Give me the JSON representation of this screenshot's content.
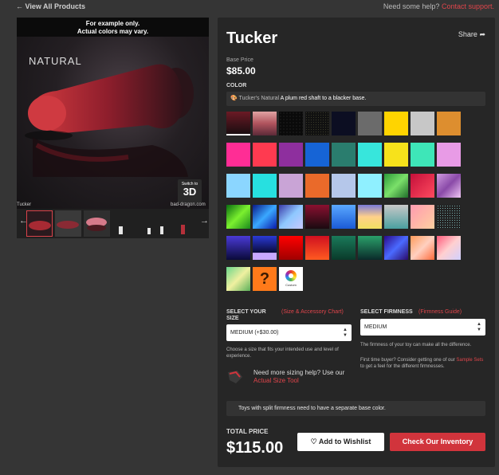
{
  "nav": {
    "back_label": "View All Products",
    "help_prefix": "Need some help?",
    "help_link": "Contact support."
  },
  "gallery": {
    "disclaimer_line1": "For example only.",
    "disclaimer_line2": "Actual colors may vary.",
    "photo_label": "NATURAL",
    "switch_small": "Switch to",
    "switch_big": "3D",
    "caption_name": "Tucker",
    "caption_site": "bad-dragon.com",
    "prev_icon": "chevron-left-icon",
    "next_icon": "chevron-right-icon"
  },
  "product": {
    "name": "Tucker",
    "share_label": "Share",
    "base_price_label": "Base Price",
    "base_price": "$85.00"
  },
  "color": {
    "label": "COLOR",
    "selected_name": "Tucker's Natural",
    "selected_desc": "A plum red shaft to a blacker base.",
    "custom_label": "Custom"
  },
  "size": {
    "label": "SELECT YOUR SIZE",
    "chart_link": "(Size & Accessory Chart)",
    "selected": "MEDIUM (+$30.00)",
    "help": "Choose a size that fits your intended use and level of experience.",
    "sizing_prefix": "Need more sizing help? Use our",
    "sizing_link": "Actual Size Tool"
  },
  "firmness": {
    "label": "SELECT FIRMNESS",
    "guide_link": "(Firmness Guide)",
    "selected": "MEDIUM",
    "help1": "The firmness of your toy can make all the difference.",
    "help2_prefix": "First time buyer? Consider getting one of our",
    "help2_link": "Sample Sets",
    "help2_suffix": "to get a feel for the different firmnesses."
  },
  "note": "Toys with split firmness need to have a separate base color.",
  "total": {
    "label": "TOTAL PRICE",
    "price": "$115.00"
  },
  "actions": {
    "wishlist": "Add to Wishlist",
    "inventory": "Check Our Inventory"
  },
  "colors": {
    "accent": "#d1343c",
    "link": "#e0454b",
    "panel": "#262626",
    "page": "#353535",
    "swatch_backgrounds": [
      [
        "linear-gradient(#6b1a25,#1a0d10)",
        "linear-gradient(#e0a3a3,#b0535d,#5c2a38)",
        "radial-gradient(circle,#333 20%,#0a0a0a 22%) 0 0/4px 4px,#0a0a0a",
        "radial-gradient(circle,#3a3a2a 20%,#111 22%) 0 0/3px 3px,#111",
        "#0c0e22",
        "#6b6b6b",
        "#ffd400",
        "#c7c7c7",
        "#dd8e2f"
      ],
      [
        "#ff2d95",
        "#ff3a50",
        "#8e2f9e",
        "#1664d6",
        "#2a7d6e",
        "#37e6dc",
        "#f7e21b",
        "#3ee6b8",
        "#e89be6"
      ],
      [
        "#8bd6ff",
        "#27e0e0",
        "#c9a4d6",
        "#ea6a2a",
        "#b5c7ea",
        "#8ff0ff",
        "linear-gradient(135deg,#2c9a3a,#7be06a,#1f6e2a)",
        "linear-gradient(135deg,#c4103a,#ff4a5f)",
        "linear-gradient(135deg,#d09be0,#8a4aa8,#f0c6f5)"
      ],
      [
        "linear-gradient(135deg,#0a6e10,#7bf02f,#1a8a1c)",
        "linear-gradient(135deg,#0a1a8a,#3aa8ff,#0a1aaa)",
        "linear-gradient(135deg,#3a3aa8,#8fc8ff,#c8c8ff)",
        "linear-gradient(#8a1030,#1a0a10)",
        "linear-gradient(#5aa8ff,#1a5ad6)",
        "linear-gradient(#7a7ad6,#ffd08a,#f0e060)",
        "linear-gradient(#c8c8c8,#4aa0a0)",
        "linear-gradient(135deg,#ff9ab0,#ffd0a0)",
        "radial-gradient(circle,#7aa 20%,#222 22%) 0 0/3px 3px,#222"
      ],
      [
        "linear-gradient(#4a3ad6,#0a0a3a)",
        "linear-gradient(#2a3ad6,#0a0a3a 70%,#c8a8ff 71%)",
        "linear-gradient(#ff0000,#a00000)",
        "linear-gradient(#d01020,#ff5a20)",
        "linear-gradient(#1a7a5a,#0a3a2a)",
        "linear-gradient(#2aa06a,#0a2a2a)",
        "linear-gradient(135deg,#2a0a8a,#4a6aff,#2a0a6a)",
        "linear-gradient(135deg,#ff9a5a,#ffd0c0,#ff6a3a)",
        "linear-gradient(135deg,#ff5a7a,#ffd0d0,#d0d0ff)"
      ],
      [
        "linear-gradient(135deg,#6ad68a,#f0f0a0,#5ab05a)",
        "#ff7a1a"
      ]
    ]
  }
}
